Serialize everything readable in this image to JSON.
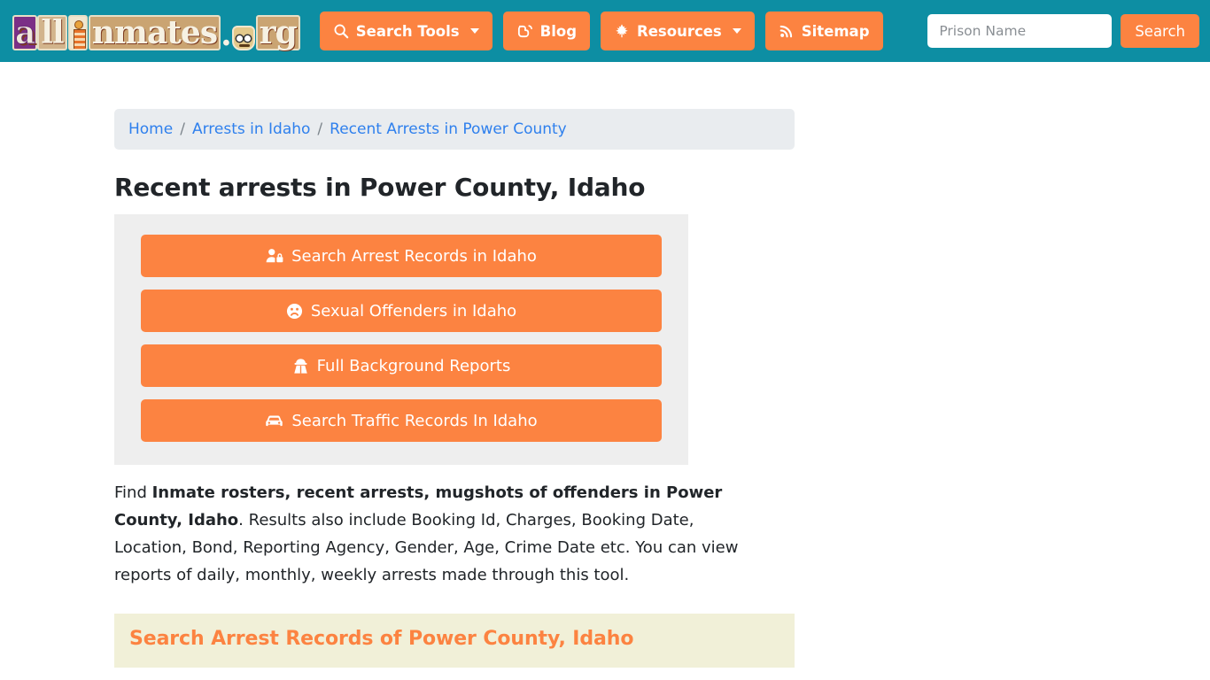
{
  "colors": {
    "header_teal": "#0d8ea3",
    "accent_orange": "#fc8341",
    "breadcrumb_bg": "#e9ecef",
    "panel_gray": "#eeeeee",
    "section_khaki": "#f1f0d8",
    "link_blue": "#2f80ed"
  },
  "header": {
    "brand": {
      "text_a": "a",
      "text_ll": "ll",
      "text_nmates": "nmates",
      "text_dot": ".",
      "text_rg": "rg",
      "full": "allInmates.org",
      "icon_i": "prisoner-icon",
      "icon_o": "handcuffed-face-icon"
    },
    "nav": [
      {
        "label": "Search Tools",
        "icon": "search-icon",
        "caret": true
      },
      {
        "label": "Blog",
        "icon": "blogger-icon",
        "caret": false
      },
      {
        "label": "Resources",
        "icon": "leaf-icon",
        "caret": true
      },
      {
        "label": "Sitemap",
        "icon": "rss-icon",
        "caret": false
      }
    ],
    "search": {
      "placeholder": "Prison Name",
      "value": "",
      "button_label": "Search"
    }
  },
  "breadcrumb": {
    "separator": "/",
    "items": [
      {
        "label": "Home"
      },
      {
        "label": "Arrests in Idaho"
      },
      {
        "label": "Recent Arrests in Power County"
      }
    ]
  },
  "main": {
    "title": "Recent arrests in Power County, Idaho",
    "buttons": [
      {
        "label": "Search Arrest Records in Idaho",
        "icon": "user-lock-icon"
      },
      {
        "label": "Sexual Offenders in Idaho",
        "icon": "frown-face-icon"
      },
      {
        "label": "Full Background Reports",
        "icon": "user-secret-icon"
      },
      {
        "label": "Search Traffic Records In Idaho",
        "icon": "car-icon"
      }
    ],
    "paragraph": {
      "before": "Find ",
      "bold": "Inmate rosters, recent arrests, mugshots of offenders in Power County, Idaho",
      "after": ". Results also include Booking Id, Charges, Booking Date, Location, Bond, Reporting Agency, Gender, Age, Crime Date etc. You can view reports of daily, monthly, weekly arrests made through this tool."
    },
    "section_heading": "Search Arrest Records of Power County, Idaho"
  }
}
